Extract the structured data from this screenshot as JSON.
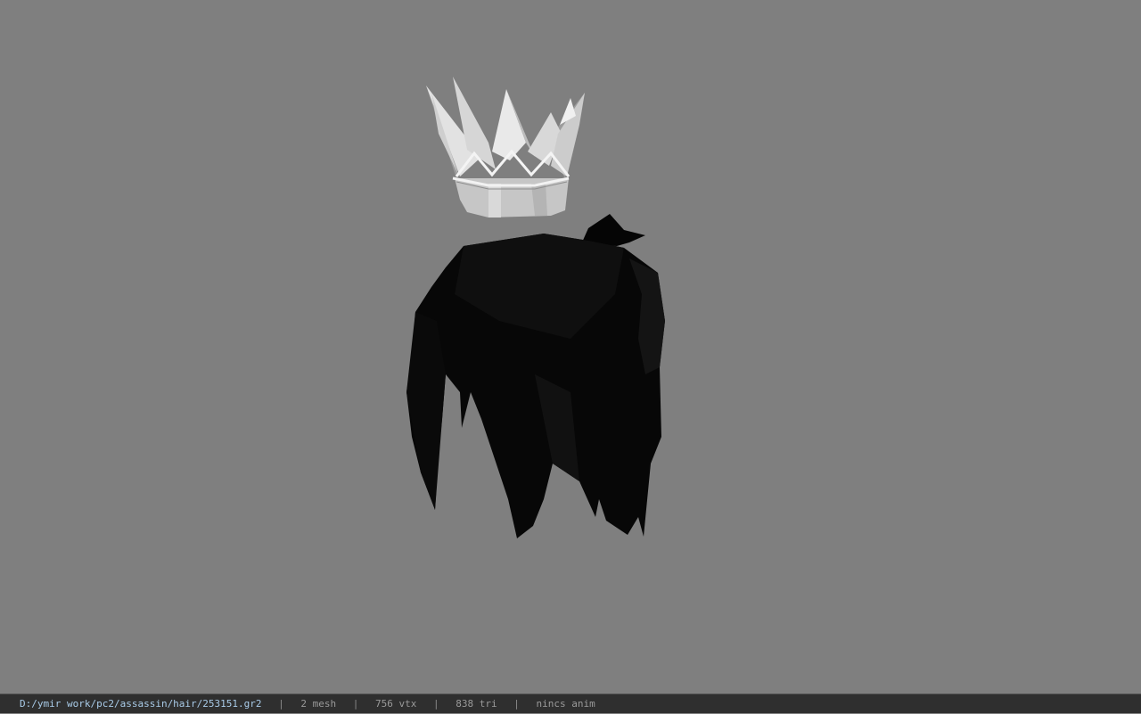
{
  "viewport": {
    "background_color": "#7f7f7f",
    "models": [
      {
        "name": "crown",
        "color": "#c8c8c8"
      },
      {
        "name": "hair",
        "color": "#050505"
      }
    ]
  },
  "status_bar": {
    "file_path": "D:/ymir work/pc2/assassin/hair/253151.gr2",
    "separator": "|",
    "mesh_count": "2 mesh",
    "vertex_count": "756 vtx",
    "triangle_count": "838 tri",
    "anim_status": "nincs anim",
    "path_color": "#a9cbe8",
    "text_color": "#9a9a9a"
  }
}
